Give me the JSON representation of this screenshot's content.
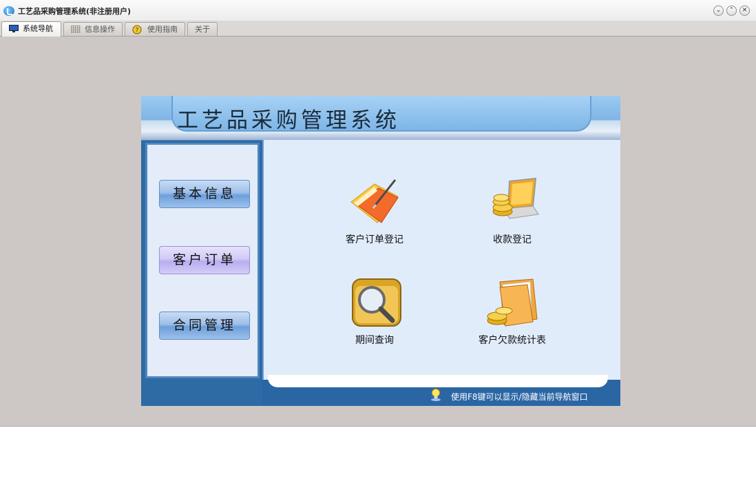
{
  "window": {
    "title": "工艺品采购管理系统(非注册用户)",
    "controls": [
      "minimize-icon",
      "restore-icon",
      "close-icon"
    ]
  },
  "tabs": [
    {
      "label": "系统导航",
      "icon": "monitor-icon",
      "active": true
    },
    {
      "label": "信息操作",
      "icon": "grid-icon",
      "active": false
    },
    {
      "label": "使用指南",
      "icon": "help-icon",
      "active": false
    },
    {
      "label": "关于",
      "icon": "",
      "active": false
    }
  ],
  "panel": {
    "title": "工艺品采购管理系统",
    "nav": [
      {
        "label": "基本信息",
        "active": false
      },
      {
        "label": "客户订单",
        "active": true
      },
      {
        "label": "合同管理",
        "active": false
      }
    ],
    "tiles": [
      {
        "label": "客户订单登记",
        "icon": "order-folder-icon"
      },
      {
        "label": "收款登记",
        "icon": "payment-laptop-icon"
      },
      {
        "label": "期间查询",
        "icon": "search-folder-icon"
      },
      {
        "label": "客户欠款统计表",
        "icon": "debt-folder-icon"
      }
    ],
    "hint": "使用F8键可以显示/隐藏当前导航窗口"
  },
  "colors": {
    "window_bg": "#cdc8c5",
    "panel_border": "#2e6aa3",
    "content_bg": "#e1ecfb",
    "header_blue": "#8fc2ee"
  }
}
